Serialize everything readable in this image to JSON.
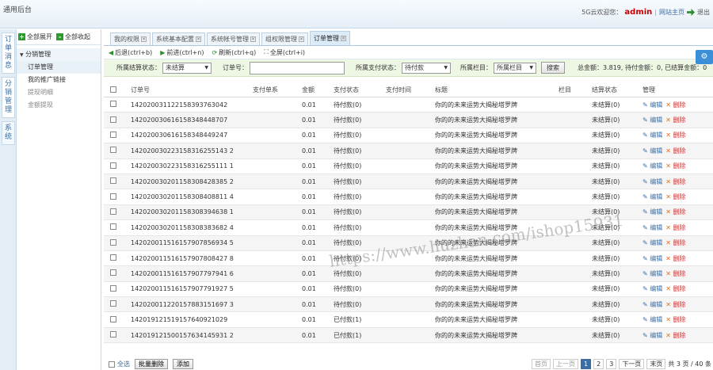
{
  "app": {
    "title": "通用后台"
  },
  "top": {
    "greeting": "5G云欢迎您：",
    "user": "admin",
    "sep": "|",
    "home_link": "网站主页",
    "logout": "退出"
  },
  "left_tabs": [
    "订单消息",
    "分销管理",
    "系统"
  ],
  "sidebar": {
    "expand_all": "全部展开",
    "collapse_all": "全部收起",
    "group": "分销管理",
    "items": [
      "订单管理",
      "我的推广链接",
      "提现明细",
      "金额提现"
    ]
  },
  "tabs": [
    "我的权限",
    "系统基本配置",
    "系统帐号管理",
    "组权限管理",
    "订单管理"
  ],
  "toolbar": {
    "back": "后退(ctrl+b)",
    "forward": "前进(ctrl+n)",
    "refresh": "刷新(ctrl+q)",
    "fullscreen": "全屏(ctrl+i)"
  },
  "filter": {
    "settle_label": "所属结算状态：",
    "settle_value": "未结算",
    "order_label": "订单号：",
    "order_value": "",
    "pay_label": "所属支付状态：",
    "pay_value": "待付款",
    "col_label": "所属栏目：",
    "col_value": "所属栏目",
    "search_btn": "搜索",
    "summary": "总金额：3.819, 待付金额：0, 已结算金额：0"
  },
  "table": {
    "headers": [
      "订单号",
      "支付单系",
      "金额",
      "支付状态",
      "支付时间",
      "标题",
      "栏目",
      "结算状态",
      "管理"
    ],
    "edit_label": "编辑",
    "delete_label": "删除",
    "rows": [
      {
        "order": "142020031122158393763042",
        "amount": "0.01",
        "pay": "待付款(0)",
        "title": "你的的未来运势大揭秘塔罗牌",
        "settle": "未结算(0)"
      },
      {
        "order": "142020030616158348448707",
        "amount": "0.01",
        "pay": "待付款(0)",
        "title": "你的的未来运势大揭秘塔罗牌",
        "settle": "未结算(0)"
      },
      {
        "order": "142020030616158348449247",
        "amount": "0.01",
        "pay": "待付款(0)",
        "title": "你的的未来运势大揭秘塔罗牌",
        "settle": "未结算(0)"
      },
      {
        "order": "142020030223158316255143 2",
        "amount": "0.01",
        "pay": "待付款(0)",
        "title": "你的的未来运势大揭秘塔罗牌",
        "settle": "未结算(0)"
      },
      {
        "order": "142020030223158316255111 1",
        "amount": "0.01",
        "pay": "待付款(0)",
        "title": "你的的未来运势大揭秘塔罗牌",
        "settle": "未结算(0)"
      },
      {
        "order": "142020030201158308428385 2",
        "amount": "0.01",
        "pay": "待付款(0)",
        "title": "你的的未来运势大揭秘塔罗牌",
        "settle": "未结算(0)"
      },
      {
        "order": "142020030201158308408811 4",
        "amount": "0.01",
        "pay": "待付款(0)",
        "title": "你的的未来运势大揭秘塔罗牌",
        "settle": "未结算(0)"
      },
      {
        "order": "142020030201158308394638 1",
        "amount": "0.01",
        "pay": "待付款(0)",
        "title": "你的的未来运势大揭秘塔罗牌",
        "settle": "未结算(0)"
      },
      {
        "order": "142020030201158308383682 4",
        "amount": "0.01",
        "pay": "待付款(0)",
        "title": "你的的未来运势大揭秘塔罗牌",
        "settle": "未结算(0)"
      },
      {
        "order": "142020011516157907856934 5",
        "amount": "0.01",
        "pay": "待付款(0)",
        "title": "你的的未来运势大揭秘塔罗牌",
        "settle": "未结算(0)"
      },
      {
        "order": "142020011516157907808427 8",
        "amount": "0.01",
        "pay": "待付款(0)",
        "title": "你的的未来运势大揭秘塔罗牌",
        "settle": "未结算(0)"
      },
      {
        "order": "142020011516157907797941 6",
        "amount": "0.01",
        "pay": "待付款(0)",
        "title": "你的的未来运势大揭秘塔罗牌",
        "settle": "未结算(0)"
      },
      {
        "order": "142020011516157907791927 5",
        "amount": "0.01",
        "pay": "待付款(0)",
        "title": "你的的未来运势大揭秘塔罗牌",
        "settle": "未结算(0)"
      },
      {
        "order": "142020011220157883151697 3",
        "amount": "0.01",
        "pay": "待付款(0)",
        "title": "你的的未来运势大揭秘塔罗牌",
        "settle": "未结算(0)"
      },
      {
        "order": "142019121519157640921029",
        "amount": "0.01",
        "pay": "已付款(1)",
        "title": "你的的未来运势大揭秘塔罗牌",
        "settle": "未结算(0)"
      },
      {
        "order": "142019121500157634145931 2",
        "amount": "0.01",
        "pay": "已付款(1)",
        "title": "你的的未来运势大揭秘塔罗牌",
        "settle": "未结算(0)"
      }
    ]
  },
  "footer": {
    "select_all": "全选",
    "batch_delete": "批量删除",
    "add": "添加",
    "pager": {
      "first": "首页",
      "prev": "上一页",
      "pages": [
        "1",
        "2",
        "3"
      ],
      "next": "下一页",
      "last": "末页",
      "summary": "共 3 页 / 40 条"
    }
  },
  "watermark": "https://www.huzhan.com/ishop15931"
}
